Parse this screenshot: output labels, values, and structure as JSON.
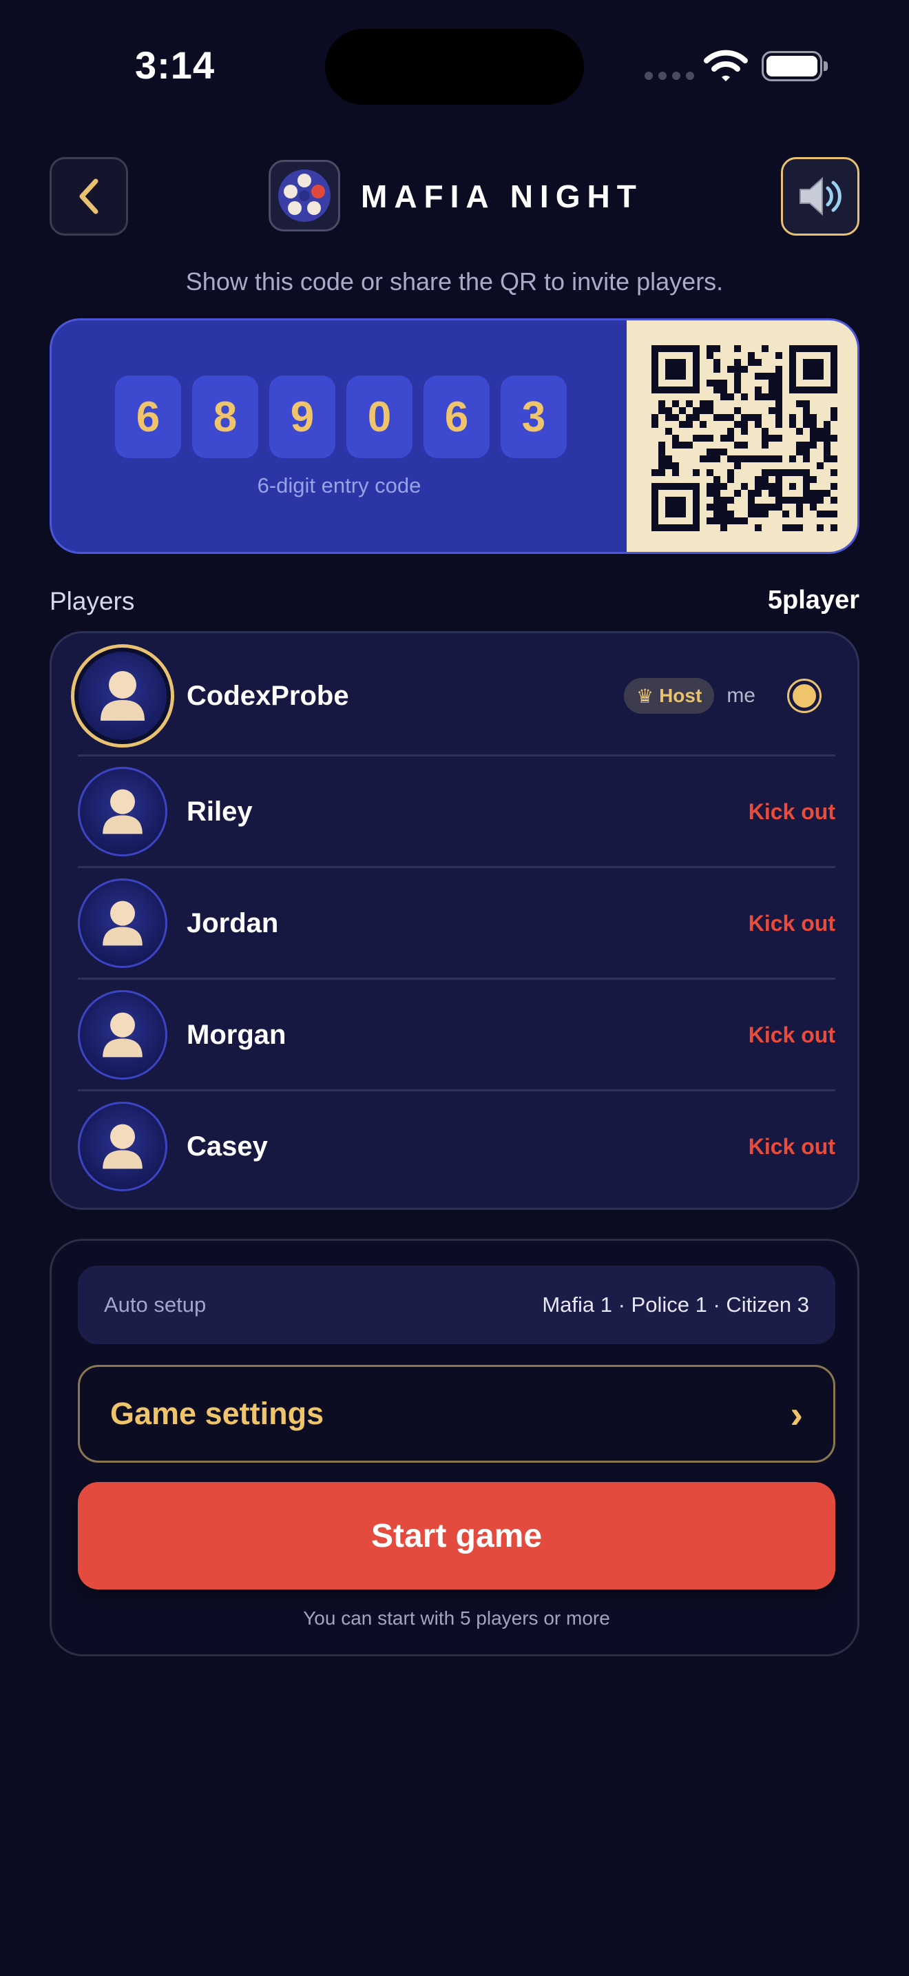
{
  "status_bar": {
    "time": "3:14"
  },
  "header": {
    "title": "MAFIA NIGHT"
  },
  "invite": {
    "instructions": "Show this code or share the QR to invite players.",
    "digits": [
      "6",
      "8",
      "9",
      "0",
      "6",
      "3"
    ],
    "caption": "6-digit entry code"
  },
  "players": {
    "label": "Players",
    "count": "5player",
    "host_badge": "Host",
    "me_label": "me",
    "kick_label": "Kick out",
    "list": [
      {
        "name": "CodexProbe"
      },
      {
        "name": "Riley"
      },
      {
        "name": "Jordan"
      },
      {
        "name": "Morgan"
      },
      {
        "name": "Casey"
      }
    ]
  },
  "setup": {
    "auto_label": "Auto setup",
    "auto_value": "Mafia 1 · Police 1 · Citizen 3",
    "settings_label": "Game settings",
    "settings_chevron": "›",
    "start_label": "Start game",
    "start_hint": "You can start with 5 players or more"
  },
  "colors": {
    "background": "#0b0c22",
    "accent_gold": "#efc46a",
    "code_card": "#2c35a6",
    "danger": "#e74c3c",
    "start_button": "#e34b3e"
  },
  "icons": {
    "back": "chevron-left-icon",
    "sound": "speaker-icon",
    "host": "crown-icon",
    "player": "person-avatar-icon"
  }
}
